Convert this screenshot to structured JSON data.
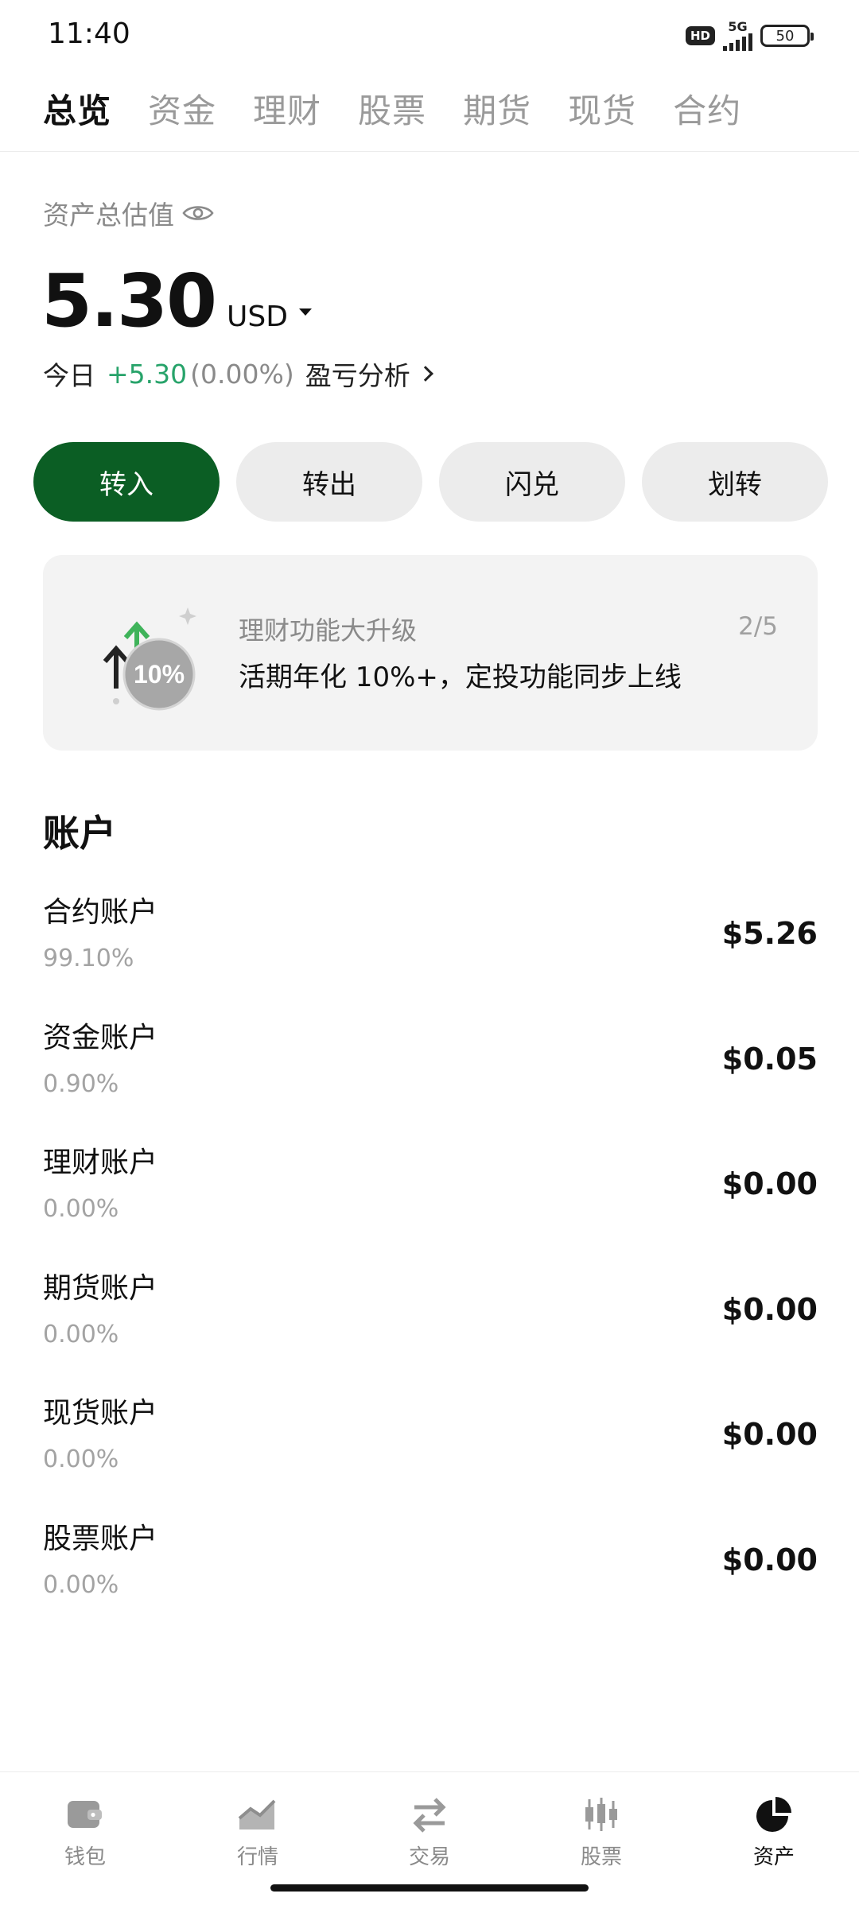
{
  "status_bar": {
    "time": "11:40",
    "hd": "HD",
    "network": "5G",
    "battery": "50"
  },
  "top_tabs": [
    {
      "label": "总览",
      "active": true
    },
    {
      "label": "资金",
      "active": false
    },
    {
      "label": "理财",
      "active": false
    },
    {
      "label": "股票",
      "active": false
    },
    {
      "label": "期货",
      "active": false
    },
    {
      "label": "现货",
      "active": false
    },
    {
      "label": "合约",
      "active": false
    }
  ],
  "asset": {
    "label": "资产总估值",
    "amount": "5.30",
    "currency": "USD",
    "today_label": "今日",
    "today_change": "+5.30",
    "today_pct": "(0.00%)",
    "pnl_link": "盈亏分析"
  },
  "actions": [
    {
      "label": "转入",
      "primary": true
    },
    {
      "label": "转出",
      "primary": false
    },
    {
      "label": "闪兑",
      "primary": false
    },
    {
      "label": "划转",
      "primary": false
    }
  ],
  "promo": {
    "title": "理财功能大升级",
    "subtitle": "活期年化 10%+，定投功能同步上线",
    "page": "2/5",
    "badge": "10%"
  },
  "accounts_title": "账户",
  "accounts": [
    {
      "name": "合约账户",
      "pct": "99.10%",
      "value": "$5.26"
    },
    {
      "name": "资金账户",
      "pct": "0.90%",
      "value": "$0.05"
    },
    {
      "name": "理财账户",
      "pct": "0.00%",
      "value": "$0.00"
    },
    {
      "name": "期货账户",
      "pct": "0.00%",
      "value": "$0.00"
    },
    {
      "name": "现货账户",
      "pct": "0.00%",
      "value": "$0.00"
    },
    {
      "name": "股票账户",
      "pct": "0.00%",
      "value": "$0.00"
    }
  ],
  "bottom_nav": [
    {
      "label": "钱包",
      "icon": "wallet-icon",
      "active": false
    },
    {
      "label": "行情",
      "icon": "market-chart-icon",
      "active": false
    },
    {
      "label": "交易",
      "icon": "swap-arrows-icon",
      "active": false
    },
    {
      "label": "股票",
      "icon": "candlestick-icon",
      "active": false
    },
    {
      "label": "资产",
      "icon": "pie-chart-icon",
      "active": true
    }
  ],
  "colors": {
    "primary_green": "#0b5e24",
    "positive": "#27a36a",
    "muted_text": "#8a8a8a"
  }
}
